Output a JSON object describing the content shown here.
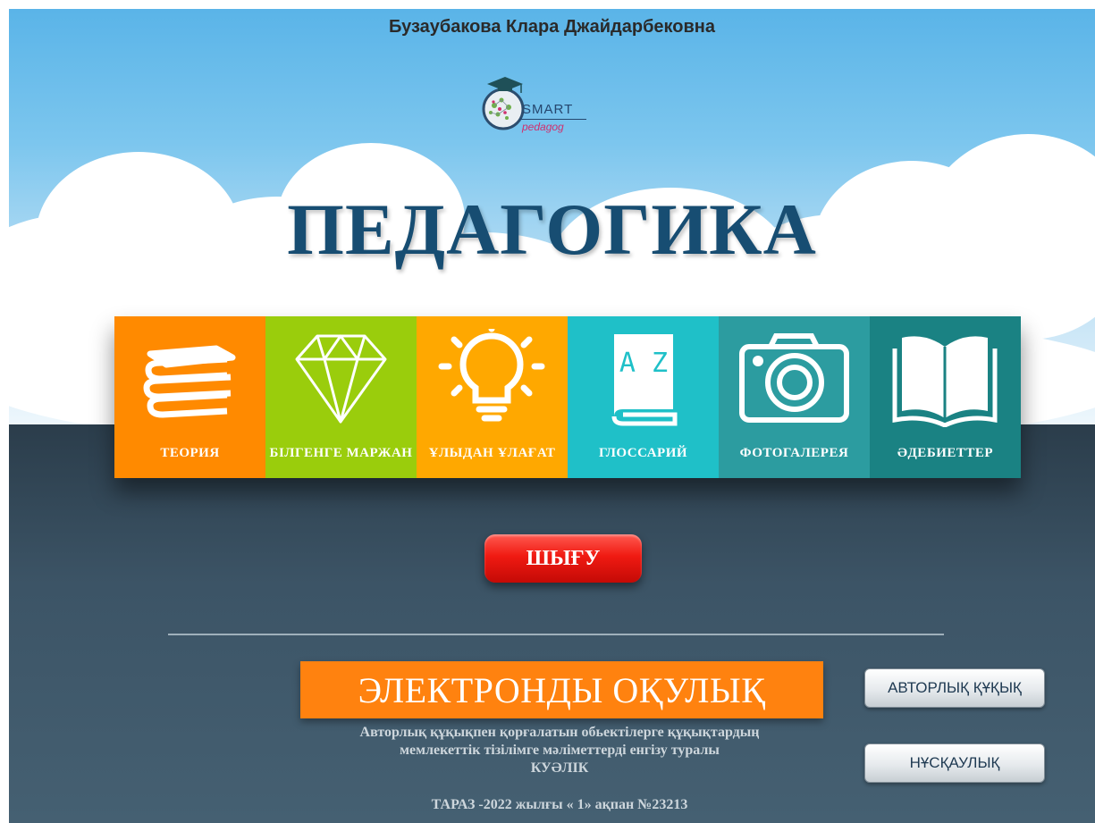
{
  "header": {
    "author": "Бузаубакова Клара Джайдарбековна",
    "logo": {
      "line1": "SMART",
      "line2": "pedagog"
    },
    "title": "ПЕДАГОГИКА"
  },
  "menu": {
    "tiles": [
      {
        "key": "theory",
        "label": "ТЕОРИЯ",
        "color": "#ff8a00",
        "icon": "books-icon"
      },
      {
        "key": "pearls",
        "label": "БІЛГЕНГЕ МАРЖАН",
        "color": "#9acd0c",
        "icon": "diamond-icon"
      },
      {
        "key": "wisdom",
        "label": "ҰЛЫДАН ҰЛАҒАТ",
        "color": "#ffa800",
        "icon": "lightbulb-icon"
      },
      {
        "key": "glossary",
        "label": "ГЛОССАРИЙ",
        "color": "#1fc0c8",
        "icon": "dictionary-az-icon"
      },
      {
        "key": "gallery",
        "label": "ФОТОГАЛЕРЕЯ",
        "color": "#2c9ca0",
        "icon": "camera-icon"
      },
      {
        "key": "literature",
        "label": "ӘДЕБИЕТТЕР",
        "color": "#1a8283",
        "icon": "open-book-icon"
      }
    ]
  },
  "exit": {
    "label": "ШЫҒУ",
    "color": "#e8120c"
  },
  "ebook": {
    "banner": "ЭЛЕКТРОНДЫ ОҚУЛЫҚ",
    "color": "#ff820f"
  },
  "certificate": {
    "line1": "Авторлық құқықпен қорғалатын обьектілерге құқықтардың",
    "line2": "мемлекеттік тізілімге мәліметтерді енгізу туралы",
    "line3": "КУӘЛІК",
    "footer": "ТАРАЗ -2022 жылғы « 1» ақпан  №23213"
  },
  "buttons": {
    "copyright": "АВТОРЛЫҚ ҚҰҚЫҚ",
    "guide": "НҰСҚАУЛЫҚ"
  }
}
